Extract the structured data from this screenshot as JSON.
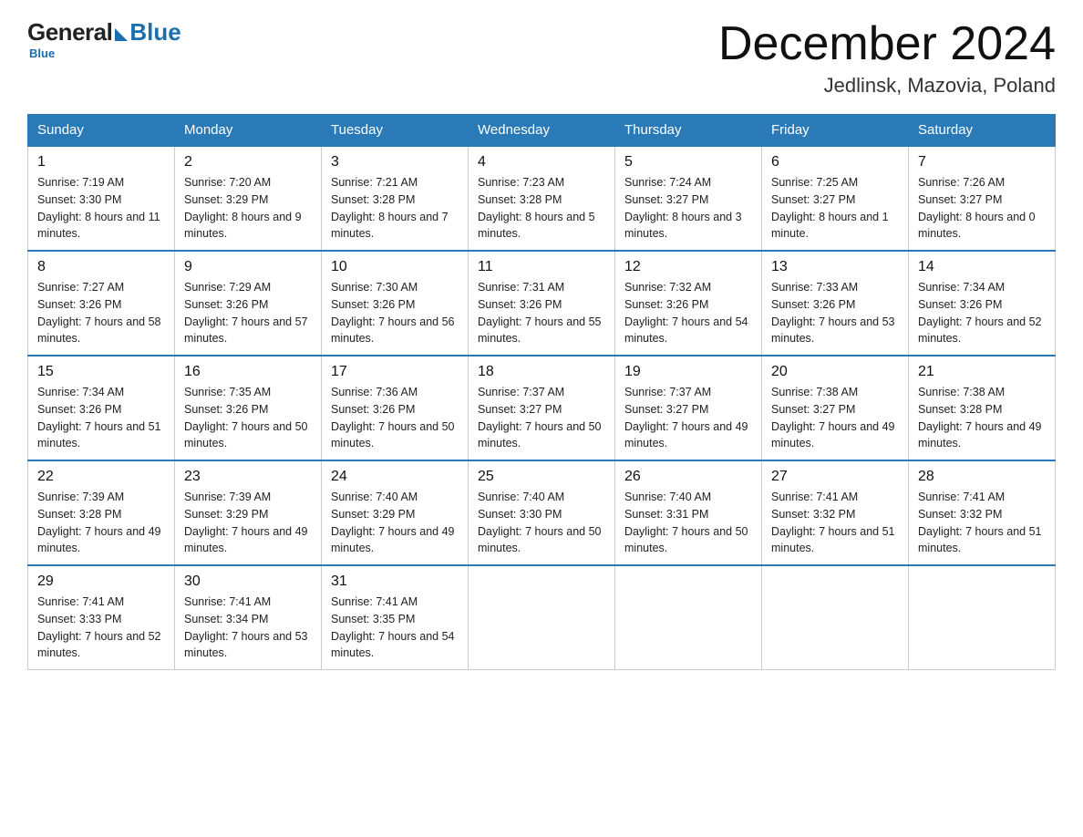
{
  "header": {
    "logo_general": "General",
    "logo_blue": "Blue",
    "month_title": "December 2024",
    "location": "Jedlinsk, Mazovia, Poland"
  },
  "days_of_week": [
    "Sunday",
    "Monday",
    "Tuesday",
    "Wednesday",
    "Thursday",
    "Friday",
    "Saturday"
  ],
  "weeks": [
    [
      {
        "day": "1",
        "sunrise": "7:19 AM",
        "sunset": "3:30 PM",
        "daylight": "8 hours and 11 minutes."
      },
      {
        "day": "2",
        "sunrise": "7:20 AM",
        "sunset": "3:29 PM",
        "daylight": "8 hours and 9 minutes."
      },
      {
        "day": "3",
        "sunrise": "7:21 AM",
        "sunset": "3:28 PM",
        "daylight": "8 hours and 7 minutes."
      },
      {
        "day": "4",
        "sunrise": "7:23 AM",
        "sunset": "3:28 PM",
        "daylight": "8 hours and 5 minutes."
      },
      {
        "day": "5",
        "sunrise": "7:24 AM",
        "sunset": "3:27 PM",
        "daylight": "8 hours and 3 minutes."
      },
      {
        "day": "6",
        "sunrise": "7:25 AM",
        "sunset": "3:27 PM",
        "daylight": "8 hours and 1 minute."
      },
      {
        "day": "7",
        "sunrise": "7:26 AM",
        "sunset": "3:27 PM",
        "daylight": "8 hours and 0 minutes."
      }
    ],
    [
      {
        "day": "8",
        "sunrise": "7:27 AM",
        "sunset": "3:26 PM",
        "daylight": "7 hours and 58 minutes."
      },
      {
        "day": "9",
        "sunrise": "7:29 AM",
        "sunset": "3:26 PM",
        "daylight": "7 hours and 57 minutes."
      },
      {
        "day": "10",
        "sunrise": "7:30 AM",
        "sunset": "3:26 PM",
        "daylight": "7 hours and 56 minutes."
      },
      {
        "day": "11",
        "sunrise": "7:31 AM",
        "sunset": "3:26 PM",
        "daylight": "7 hours and 55 minutes."
      },
      {
        "day": "12",
        "sunrise": "7:32 AM",
        "sunset": "3:26 PM",
        "daylight": "7 hours and 54 minutes."
      },
      {
        "day": "13",
        "sunrise": "7:33 AM",
        "sunset": "3:26 PM",
        "daylight": "7 hours and 53 minutes."
      },
      {
        "day": "14",
        "sunrise": "7:34 AM",
        "sunset": "3:26 PM",
        "daylight": "7 hours and 52 minutes."
      }
    ],
    [
      {
        "day": "15",
        "sunrise": "7:34 AM",
        "sunset": "3:26 PM",
        "daylight": "7 hours and 51 minutes."
      },
      {
        "day": "16",
        "sunrise": "7:35 AM",
        "sunset": "3:26 PM",
        "daylight": "7 hours and 50 minutes."
      },
      {
        "day": "17",
        "sunrise": "7:36 AM",
        "sunset": "3:26 PM",
        "daylight": "7 hours and 50 minutes."
      },
      {
        "day": "18",
        "sunrise": "7:37 AM",
        "sunset": "3:27 PM",
        "daylight": "7 hours and 50 minutes."
      },
      {
        "day": "19",
        "sunrise": "7:37 AM",
        "sunset": "3:27 PM",
        "daylight": "7 hours and 49 minutes."
      },
      {
        "day": "20",
        "sunrise": "7:38 AM",
        "sunset": "3:27 PM",
        "daylight": "7 hours and 49 minutes."
      },
      {
        "day": "21",
        "sunrise": "7:38 AM",
        "sunset": "3:28 PM",
        "daylight": "7 hours and 49 minutes."
      }
    ],
    [
      {
        "day": "22",
        "sunrise": "7:39 AM",
        "sunset": "3:28 PM",
        "daylight": "7 hours and 49 minutes."
      },
      {
        "day": "23",
        "sunrise": "7:39 AM",
        "sunset": "3:29 PM",
        "daylight": "7 hours and 49 minutes."
      },
      {
        "day": "24",
        "sunrise": "7:40 AM",
        "sunset": "3:29 PM",
        "daylight": "7 hours and 49 minutes."
      },
      {
        "day": "25",
        "sunrise": "7:40 AM",
        "sunset": "3:30 PM",
        "daylight": "7 hours and 50 minutes."
      },
      {
        "day": "26",
        "sunrise": "7:40 AM",
        "sunset": "3:31 PM",
        "daylight": "7 hours and 50 minutes."
      },
      {
        "day": "27",
        "sunrise": "7:41 AM",
        "sunset": "3:32 PM",
        "daylight": "7 hours and 51 minutes."
      },
      {
        "day": "28",
        "sunrise": "7:41 AM",
        "sunset": "3:32 PM",
        "daylight": "7 hours and 51 minutes."
      }
    ],
    [
      {
        "day": "29",
        "sunrise": "7:41 AM",
        "sunset": "3:33 PM",
        "daylight": "7 hours and 52 minutes."
      },
      {
        "day": "30",
        "sunrise": "7:41 AM",
        "sunset": "3:34 PM",
        "daylight": "7 hours and 53 minutes."
      },
      {
        "day": "31",
        "sunrise": "7:41 AM",
        "sunset": "3:35 PM",
        "daylight": "7 hours and 54 minutes."
      },
      null,
      null,
      null,
      null
    ]
  ]
}
